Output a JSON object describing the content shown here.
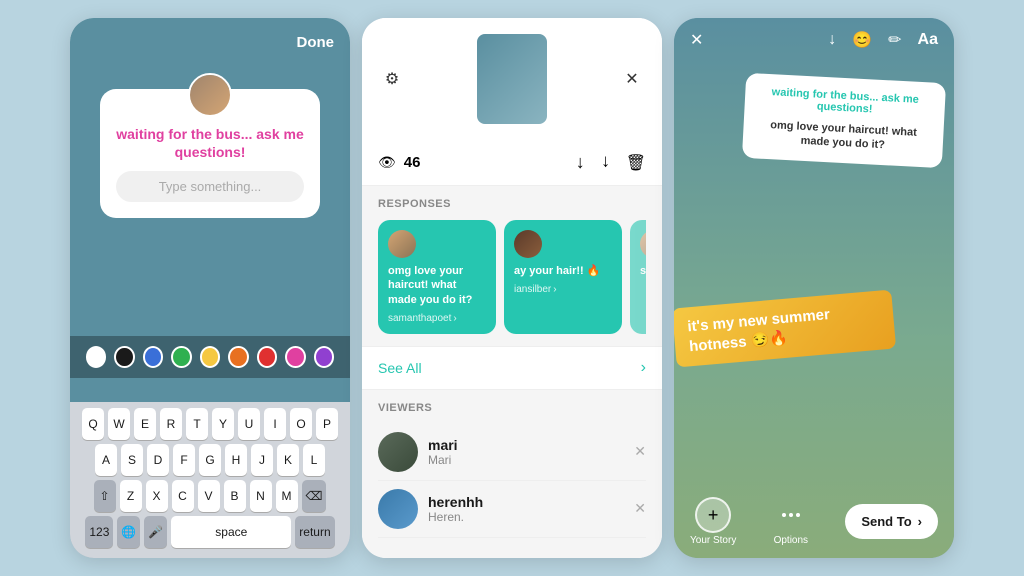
{
  "screen1": {
    "done_label": "Done",
    "question_text": "waiting for the bus... ask me questions!",
    "input_placeholder": "Type something...",
    "colors": [
      "#ffffff",
      "#1a1a1a",
      "#3a6fd8",
      "#2fb050",
      "#f5c842",
      "#e87020",
      "#e03030",
      "#e040a0",
      "#9040d0"
    ],
    "keyboard": {
      "row1": [
        "Q",
        "W",
        "E",
        "R",
        "T",
        "Y",
        "U",
        "I",
        "O",
        "P"
      ],
      "row2": [
        "A",
        "S",
        "D",
        "F",
        "G",
        "H",
        "J",
        "K",
        "L"
      ],
      "row3": [
        "⇧",
        "Z",
        "X",
        "C",
        "V",
        "B",
        "N",
        "M",
        "⌫"
      ],
      "row4": [
        "123",
        "🌐",
        "🎤",
        "space",
        "return"
      ]
    }
  },
  "screen2": {
    "settings_icon": "⚙",
    "close_icon": "✕",
    "views_count": "46",
    "download_icon": "↓",
    "share_icon": "↑",
    "delete_icon": "🗑",
    "responses_label": "RESPONSES",
    "responses": [
      {
        "text": "omg love your haircut! what made you do it?",
        "username": "samanthapoet"
      },
      {
        "text": "ay your hair!! 🔥",
        "username": "iansilber"
      },
      {
        "text": "sa... te... s...",
        "username": "..."
      }
    ],
    "see_all_label": "See All",
    "viewers_label": "VIEWERS",
    "viewers": [
      {
        "name": "mari",
        "handle": "Mari"
      },
      {
        "name": "herenhh",
        "handle": "Heren."
      }
    ]
  },
  "screen3": {
    "close_icon": "✕",
    "download_icon": "↓",
    "sticker_icon": "😊",
    "edit_icon": "✏",
    "text_icon": "Aa",
    "question_text": "waiting for the bus... ask me questions!",
    "answer_preview": "omg love your haircut! what made you do it?",
    "answer_sticker": "it's my new summer hotness 😏🔥",
    "your_story_label": "Your Story",
    "options_label": "Options",
    "send_to_label": "Send To"
  }
}
